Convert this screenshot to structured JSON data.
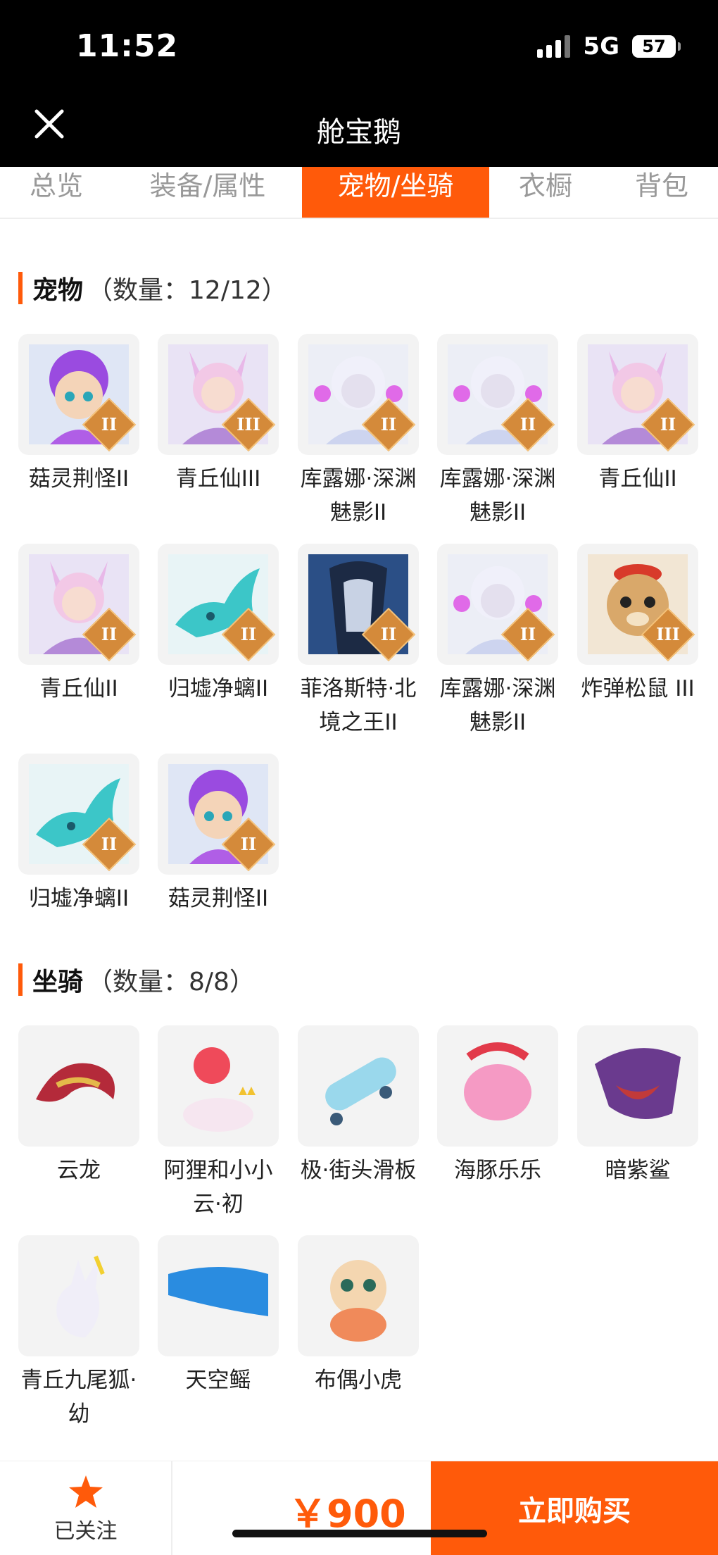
{
  "status": {
    "time": "11:52",
    "network": "5G",
    "battery": "57"
  },
  "nav": {
    "title": "舱宝鹅"
  },
  "tabs": [
    {
      "label": "总览",
      "active": false
    },
    {
      "label": "装备/属性",
      "active": false
    },
    {
      "label": "宠物/坐骑",
      "active": true
    },
    {
      "label": "衣橱",
      "active": false
    },
    {
      "label": "背包",
      "active": false
    }
  ],
  "pets": {
    "title": "宠物",
    "count": "（数量：12/12）",
    "items": [
      {
        "name": "菇灵荆怪II",
        "level": "II",
        "icon": "mushroom-spirit-icon"
      },
      {
        "name": "青丘仙III",
        "level": "III",
        "icon": "fox-fairy-icon"
      },
      {
        "name": "库露娜·深渊魅影II",
        "level": "II",
        "icon": "kuluna-icon"
      },
      {
        "name": "库露娜·深渊魅影II",
        "level": "II",
        "icon": "kuluna-icon"
      },
      {
        "name": "青丘仙II",
        "level": "II",
        "icon": "fox-fairy-icon"
      },
      {
        "name": "青丘仙II",
        "level": "II",
        "icon": "fox-fairy-icon"
      },
      {
        "name": "归墟净螭II",
        "level": "II",
        "icon": "cyan-dragon-icon"
      },
      {
        "name": "菲洛斯特·北境之王II",
        "level": "II",
        "icon": "north-king-icon"
      },
      {
        "name": "库露娜·深渊魅影II",
        "level": "II",
        "icon": "kuluna-icon"
      },
      {
        "name": "炸弹松鼠 III",
        "level": "III",
        "icon": "bomb-squirrel-icon"
      },
      {
        "name": "归墟净螭II",
        "level": "II",
        "icon": "cyan-dragon-icon"
      },
      {
        "name": "菇灵荆怪II",
        "level": "II",
        "icon": "mushroom-spirit-icon"
      }
    ]
  },
  "mounts": {
    "title": "坐骑",
    "count": "（数量：8/8）",
    "items": [
      {
        "name": "云龙",
        "icon": "cloud-dragon-icon"
      },
      {
        "name": "阿狸和小小云·初",
        "icon": "ali-fox-cloud-icon"
      },
      {
        "name": "极·街头滑板",
        "icon": "skateboard-icon"
      },
      {
        "name": "海豚乐乐",
        "icon": "dolphin-icon"
      },
      {
        "name": "暗紫鲨",
        "icon": "purple-shark-icon"
      },
      {
        "name": "青丘九尾狐·幼",
        "icon": "nine-tail-fox-icon"
      },
      {
        "name": "天空鳐",
        "icon": "sky-ray-icon"
      },
      {
        "name": "布偶小虎",
        "icon": "cloth-tiger-icon"
      }
    ]
  },
  "bottom": {
    "follow_label": "已关注",
    "price": "￥900",
    "buy_label": "立即购买"
  },
  "colors": {
    "accent": "#ff5a0a",
    "nav_bg": "#000000"
  }
}
